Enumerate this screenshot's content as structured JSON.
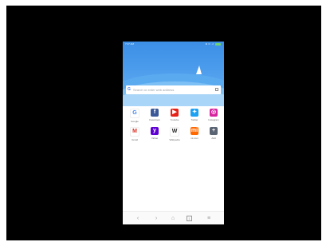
{
  "status_bar": {
    "time": "7:47 AM",
    "indicators": "⊕ ⊙ .ıl"
  },
  "search": {
    "placeholder": "Search or enter web address"
  },
  "shortcuts": [
    {
      "label": "Google",
      "glyph": "G",
      "fg": "#4285f4",
      "bg": "#ffffff",
      "icon": "google-icon"
    },
    {
      "label": "Facebook",
      "glyph": "f",
      "fg": "#ffffff",
      "bg": "#3b5998",
      "icon": "facebook-icon"
    },
    {
      "label": "Youtube",
      "glyph": "▶",
      "fg": "#ffffff",
      "bg": "#e62117",
      "icon": "youtube-icon"
    },
    {
      "label": "Twitter",
      "glyph": "✦",
      "fg": "#ffffff",
      "bg": "#1da1f2",
      "icon": "twitter-icon"
    },
    {
      "label": "Instagram",
      "glyph": "◎",
      "fg": "#ffffff",
      "bg": "#d6249f",
      "icon": "instagram-icon"
    },
    {
      "label": "Gmail",
      "glyph": "M",
      "fg": "#d93025",
      "bg": "#ffffff",
      "icon": "gmail-icon"
    },
    {
      "label": "Yahoo",
      "glyph": "y",
      "fg": "#ffffff",
      "bg": "#5f01d1",
      "icon": "yahoo-icon"
    },
    {
      "label": "Wikipedia",
      "glyph": "W",
      "fg": "#222222",
      "bg": "#ffffff",
      "icon": "wikipedia-icon"
    },
    {
      "label": "mi.com",
      "glyph": "mi",
      "fg": "#ffffff",
      "bg": "#ff6900",
      "icon": "mi-icon"
    },
    {
      "label": "Add",
      "glyph": "+",
      "fg": "#ffffff",
      "bg": "#5a6472",
      "icon": "add-icon"
    }
  ],
  "nav": {
    "back": "‹",
    "forward": "›",
    "home": "⌂",
    "tabs": "1",
    "menu": "≡"
  }
}
